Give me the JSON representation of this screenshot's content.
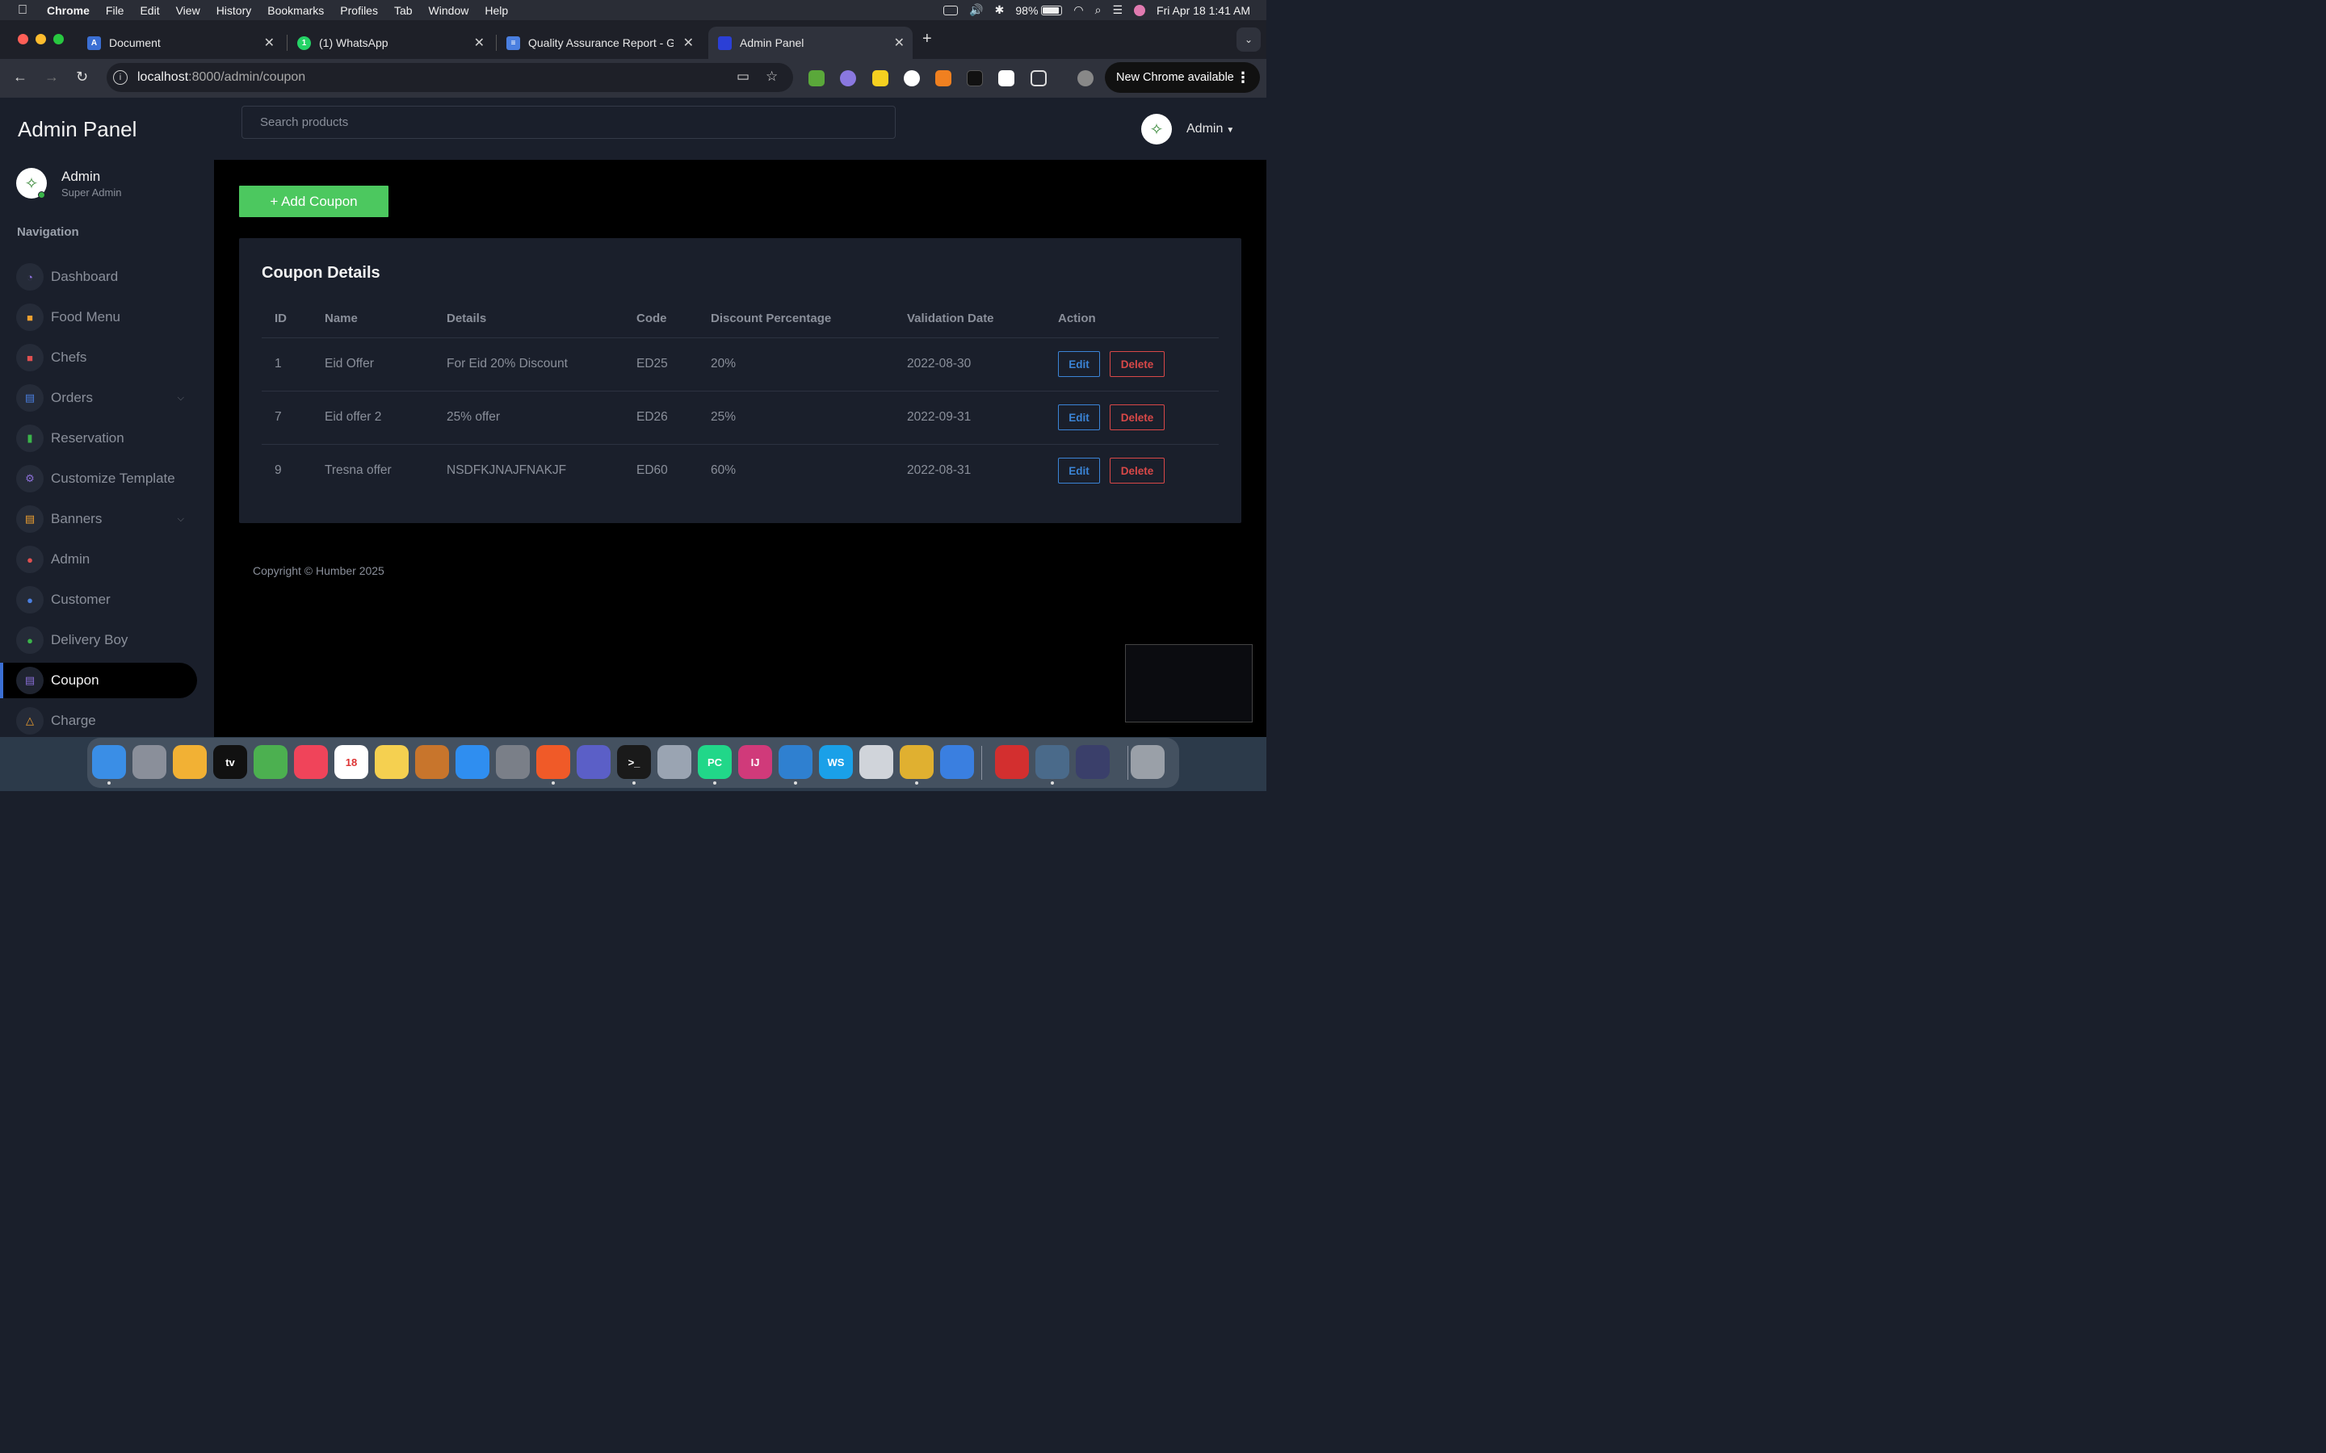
{
  "menubar": {
    "app": "Chrome",
    "items": [
      "File",
      "Edit",
      "View",
      "History",
      "Bookmarks",
      "Profiles",
      "Tab",
      "Window",
      "Help"
    ],
    "battery": "98%",
    "datetime": "Fri Apr 18  1:41 AM"
  },
  "tabs": [
    {
      "title": "Document",
      "icon": "document-favicon-icon",
      "color": "#3b6fd4"
    },
    {
      "title": "(1) WhatsApp",
      "icon": "whatsapp-favicon-icon",
      "color": "#25d366"
    },
    {
      "title": "Quality Assurance Report - G",
      "icon": "google-docs-favicon-icon",
      "color": "#4a7fe0"
    },
    {
      "title": "Admin Panel",
      "icon": "admin-favicon-icon",
      "color": "#2b3fd6"
    }
  ],
  "omnibox": {
    "host": "localhost",
    "path": ":8000/admin/coupon"
  },
  "update_button": "New Chrome available",
  "sidebar": {
    "brand": "Admin Panel",
    "profile_name": "Admin",
    "profile_role": "Super Admin",
    "nav_heading": "Navigation",
    "items": [
      {
        "label": "Dashboard",
        "icon": "gauge-icon",
        "icon_color": "#8b6fd8"
      },
      {
        "label": "Food Menu",
        "icon": "food-icon",
        "icon_color": "#f0a030"
      },
      {
        "label": "Chefs",
        "icon": "chef-icon",
        "icon_color": "#e05050"
      },
      {
        "label": "Orders",
        "icon": "orders-icon",
        "icon_color": "#4a7fe0"
      },
      {
        "label": "Reservation",
        "icon": "bar-chart-icon",
        "icon_color": "#3bb54a"
      },
      {
        "label": "Customize Template",
        "icon": "gear-icon",
        "icon_color": "#8b6fd8"
      },
      {
        "label": "Banners",
        "icon": "banner-icon",
        "icon_color": "#f0a030"
      },
      {
        "label": "Admin",
        "icon": "users-icon",
        "icon_color": "#e05050"
      },
      {
        "label": "Customer",
        "icon": "customer-icon",
        "icon_color": "#4a7fe0"
      },
      {
        "label": "Delivery Boy",
        "icon": "delivery-icon",
        "icon_color": "#3bb54a"
      },
      {
        "label": "Coupon",
        "icon": "coupon-icon",
        "icon_color": "#8b6fd8"
      },
      {
        "label": "Charge",
        "icon": "bank-icon",
        "icon_color": "#f0a030"
      }
    ]
  },
  "topbar": {
    "search_placeholder": "Search products",
    "user": "Admin"
  },
  "main": {
    "add_button": "+ Add Coupon",
    "card_title": "Coupon Details",
    "columns": [
      "ID",
      "Name",
      "Details",
      "Code",
      "Discount Percentage",
      "Validation Date",
      "Action"
    ],
    "rows": [
      {
        "id": "1",
        "name": "Eid Offer",
        "details": "For Eid 20% Discount",
        "code": "ED25",
        "discount": "20%",
        "date": "2022-08-30"
      },
      {
        "id": "7",
        "name": "Eid offer 2",
        "details": "25% offer",
        "code": "ED26",
        "discount": "25%",
        "date": "2022-09-31"
      },
      {
        "id": "9",
        "name": "Tresna offer",
        "details": "NSDFKJNAJFNAKJF",
        "code": "ED60",
        "discount": "60%",
        "date": "2022-08-31"
      }
    ],
    "edit_label": "Edit",
    "delete_label": "Delete",
    "footer": "Copyright © Humber 2025"
  },
  "dock": {
    "apps": [
      {
        "name": "finder-icon",
        "color": "#3a8ee6"
      },
      {
        "name": "launchpad-icon",
        "color": "#8a8f9a"
      },
      {
        "name": "photos-icon",
        "color": "#f2b134"
      },
      {
        "name": "apple-tv-icon",
        "color": "#111111",
        "label": "tv"
      },
      {
        "name": "maps-icon",
        "color": "#4cb050"
      },
      {
        "name": "music-icon",
        "color": "#f0445a"
      },
      {
        "name": "calendar-icon",
        "color": "#ffffff",
        "label": "18"
      },
      {
        "name": "notes-icon",
        "color": "#f5d050"
      },
      {
        "name": "garageband-icon",
        "color": "#c8752c"
      },
      {
        "name": "app-store-icon",
        "color": "#2f8ef0"
      },
      {
        "name": "system-settings-icon",
        "color": "#7a7f88"
      },
      {
        "name": "brave-icon",
        "color": "#f05a28"
      },
      {
        "name": "teams-icon",
        "color": "#5b5fc7"
      },
      {
        "name": "terminal-icon",
        "color": "#1a1a1a",
        "label": ">_"
      },
      {
        "name": "database-icon",
        "color": "#9aa4b2"
      },
      {
        "name": "pycharm-icon",
        "color": "#21d789",
        "label": "PC"
      },
      {
        "name": "intellij-icon",
        "color": "#d03a7a",
        "label": "IJ"
      },
      {
        "name": "vscode-icon",
        "color": "#2f80d0"
      },
      {
        "name": "webstorm-icon",
        "color": "#1aa0e8",
        "label": "WS"
      },
      {
        "name": "tableplus-icon",
        "color": "#d0d4da"
      },
      {
        "name": "chrome-icon",
        "color": "#e0b030"
      },
      {
        "name": "xcode-instruments-icon",
        "color": "#3a7fe0"
      },
      {
        "name": "acrobat-icon",
        "color": "#d32f2f"
      },
      {
        "name": "mysql-workbench-icon",
        "color": "#4a6a8a"
      },
      {
        "name": "ram-monitor-icon",
        "color": "#3a3f6a"
      },
      {
        "name": "trash-icon",
        "color": "#9aa0a8"
      }
    ]
  }
}
